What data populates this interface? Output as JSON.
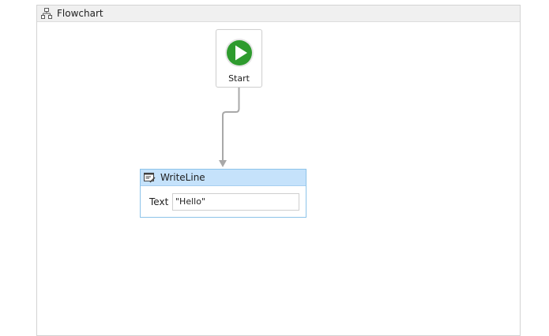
{
  "flowchart": {
    "title": "Flowchart",
    "start_node": {
      "label": "Start"
    },
    "writeline": {
      "title": "WriteLine",
      "text_label": "Text",
      "text_value": "\"Hello\""
    }
  },
  "icons": {
    "header": "flowchart-icon",
    "start": "play-icon",
    "writeline": "writeline-icon"
  },
  "colors": {
    "start_green": "#2e9b2e",
    "activity_header": "#c5e2fb",
    "activity_border": "#8dc3e9",
    "connector": "#a8a8a8"
  }
}
